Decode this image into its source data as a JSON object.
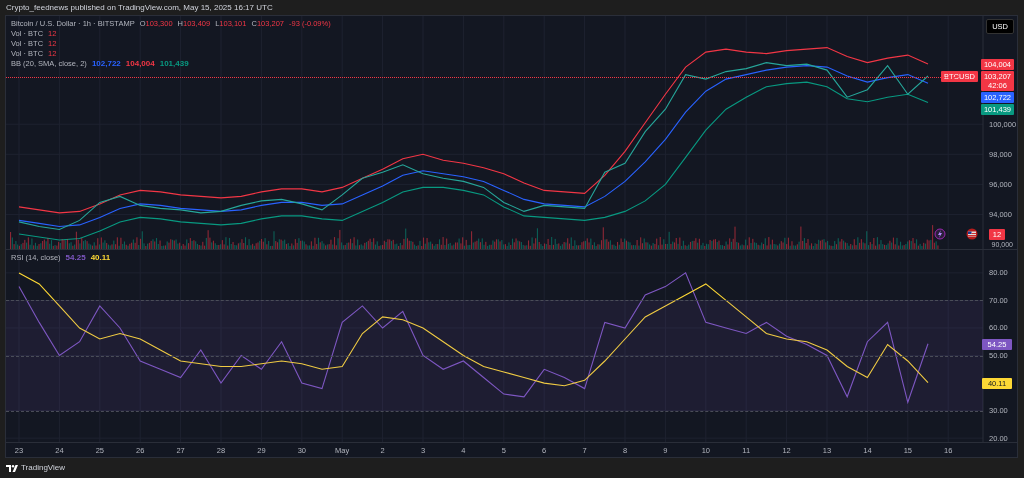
{
  "header": {
    "text": "Crypto_feednews published on TradingView.com, May 15, 2025 16:17 UTC"
  },
  "legend": {
    "symbol": "Bitcoin / U.S. Dollar · 1h · BITSTAMP",
    "ohlc": [
      {
        "key": "O",
        "value": "103,300"
      },
      {
        "key": "H",
        "value": "103,409"
      },
      {
        "key": "L",
        "value": "103,101"
      },
      {
        "key": "C",
        "value": "103,207"
      }
    ],
    "change": "-93 (-0.09%)",
    "indicators": [
      {
        "name": "Vol · BTC",
        "values": [
          {
            "text": "12"
          }
        ]
      },
      {
        "name": "Vol · BTC",
        "values": [
          {
            "text": "12"
          }
        ]
      },
      {
        "name": "Vol · BTC",
        "values": [
          {
            "text": "12"
          }
        ]
      },
      {
        "name": "BB (20, SMA, close, 2)",
        "values": [
          {
            "text": "102,722",
            "color": "#2962ff"
          },
          {
            "text": "104,004",
            "color": "#f23645"
          },
          {
            "text": "101,439",
            "color": "#089981"
          }
        ]
      }
    ]
  },
  "currency_button": "USD",
  "price_pane": {
    "chart_data": {
      "type": "line",
      "grid": true,
      "categories": [
        null,
        null,
        null,
        null,
        null,
        null,
        null,
        null,
        null,
        null,
        null,
        null,
        null,
        null,
        null,
        null,
        null,
        null,
        null,
        null,
        null,
        null,
        null,
        null,
        null,
        null,
        null,
        null,
        null,
        null,
        null,
        null,
        null,
        null,
        null,
        null,
        null,
        null,
        null,
        null,
        null,
        null,
        null,
        null,
        null,
        null
      ],
      "series": [
        {
          "color": "#f23645",
          "values": [
            94500,
            94300,
            94100,
            94200,
            94700,
            95300,
            95600,
            95500,
            95300,
            95200,
            95100,
            95200,
            95500,
            95700,
            95700,
            95500,
            95800,
            96400,
            97000,
            97700,
            98000,
            97600,
            97400,
            97100,
            96700,
            96100,
            95600,
            95500,
            95400,
            96600,
            98200,
            100100,
            102000,
            103800,
            104800,
            105000,
            104800,
            104700,
            104900,
            105000,
            105100,
            104500,
            104100,
            104400,
            104600,
            104004
          ]
        },
        {
          "color": "#089981",
          "values": [
            92700,
            92500,
            92300,
            92400,
            92900,
            93500,
            93800,
            93700,
            93500,
            93400,
            93300,
            93400,
            93700,
            93900,
            93900,
            93700,
            93600,
            94200,
            94800,
            95500,
            95800,
            95800,
            95600,
            95300,
            94500,
            93900,
            93800,
            93700,
            93600,
            93800,
            94200,
            94900,
            96000,
            97800,
            99600,
            101000,
            101800,
            102500,
            102700,
            102800,
            102500,
            101700,
            101500,
            101800,
            102000,
            101439
          ]
        },
        {
          "color": "#2962ff",
          "values": [
            93600,
            93400,
            93200,
            93300,
            93800,
            94400,
            94700,
            94600,
            94400,
            94300,
            94200,
            94300,
            94600,
            94800,
            94800,
            94600,
            94700,
            95300,
            95900,
            96600,
            96900,
            96700,
            96500,
            96200,
            95600,
            95000,
            94700,
            94600,
            94500,
            95200,
            96200,
            97500,
            99000,
            100800,
            102200,
            103000,
            103300,
            103600,
            103800,
            103900,
            103800,
            103200,
            102800,
            103100,
            103300,
            102722
          ]
        },
        {
          "color": "#26a69a",
          "values": [
            93500,
            93200,
            93000,
            93600,
            94800,
            95200,
            94600,
            94400,
            94300,
            94100,
            94200,
            94600,
            94900,
            95000,
            94700,
            94300,
            95300,
            96400,
            96800,
            97300,
            96700,
            96400,
            96200,
            95800,
            94800,
            94200,
            94600,
            94500,
            94400,
            96800,
            97400,
            99500,
            101000,
            103300,
            103000,
            103500,
            103700,
            104100,
            103900,
            104000,
            103600,
            101800,
            102300,
            103900,
            102000,
            103207
          ]
        }
      ],
      "ylim": [
        91700,
        107200
      ],
      "yticks": [
        {
          "value": 94000,
          "label": "94,000"
        },
        {
          "value": 96000,
          "label": "96,000"
        },
        {
          "value": 98000,
          "label": "98,000"
        },
        {
          "value": 100000,
          "label": "100,000"
        }
      ]
    },
    "edge_label": "90,000",
    "tags": [
      {
        "text": "104,004",
        "color": "#f23645"
      },
      {
        "label": "BTCUSD",
        "text": "103,207",
        "countdown": "42:06",
        "color": "#f23645"
      },
      {
        "text": "102,722",
        "color": "#2962ff"
      },
      {
        "text": "101,439",
        "color": "#089981"
      }
    ],
    "volume_tag": {
      "text": "12"
    }
  },
  "rsi_legend": {
    "title": "RSI (14, close)",
    "values": [
      {
        "text": "54.25",
        "color": "#7e57c2"
      },
      {
        "text": "40.11",
        "color": "#fdd835"
      }
    ]
  },
  "rsi_pane": {
    "chart_data": {
      "type": "line",
      "grid": true,
      "categories": [
        "23",
        null,
        "24",
        null,
        "25",
        null,
        "26",
        null,
        "27",
        null,
        "28",
        null,
        "29",
        null,
        "30",
        null,
        "May",
        null,
        "2",
        null,
        "3",
        null,
        "4",
        null,
        "5",
        null,
        "6",
        null,
        "7",
        null,
        "8",
        null,
        "9",
        null,
        "10",
        null,
        "11",
        null,
        "12",
        null,
        "13",
        null,
        "14",
        null,
        "15",
        null,
        "16",
        null
      ],
      "series": [
        {
          "color": "#7e57c2",
          "values": [
            75,
            62,
            50,
            55,
            68,
            60,
            48,
            45,
            42,
            52,
            40,
            50,
            45,
            55,
            40,
            38,
            62,
            68,
            60,
            66,
            50,
            45,
            48,
            42,
            36,
            35,
            45,
            42,
            38,
            62,
            60,
            72,
            75,
            80,
            62,
            60,
            58,
            62,
            57,
            54,
            50,
            35,
            55,
            62,
            33,
            54.25,
            null,
            null
          ]
        },
        {
          "color": "#fdd835",
          "values": [
            80,
            76,
            68,
            60,
            56,
            58,
            56,
            52,
            48,
            47,
            46,
            46,
            47,
            48,
            47,
            45,
            46,
            58,
            64,
            63,
            60,
            55,
            50,
            46,
            44,
            42,
            40,
            39,
            41,
            48,
            56,
            64,
            68,
            72,
            76,
            70,
            64,
            58,
            56,
            55,
            52,
            46,
            42,
            54,
            48,
            40.11,
            null,
            null
          ]
        }
      ],
      "ylim": [
        18.6,
        88.3
      ],
      "yticks": [
        {
          "value": 20,
          "label": "20.00"
        },
        {
          "value": 30,
          "label": "30.00"
        },
        {
          "value": 50,
          "label": "50.00"
        },
        {
          "value": 60,
          "label": "60.00"
        },
        {
          "value": 70,
          "label": "70.00"
        },
        {
          "value": 80,
          "label": "80.00"
        }
      ]
    },
    "tags": [
      {
        "text": "54.25",
        "color": "#7e57c2"
      },
      {
        "text": "40.11",
        "color": "#fdd835"
      }
    ]
  },
  "footer": {
    "brand": "TradingView"
  }
}
